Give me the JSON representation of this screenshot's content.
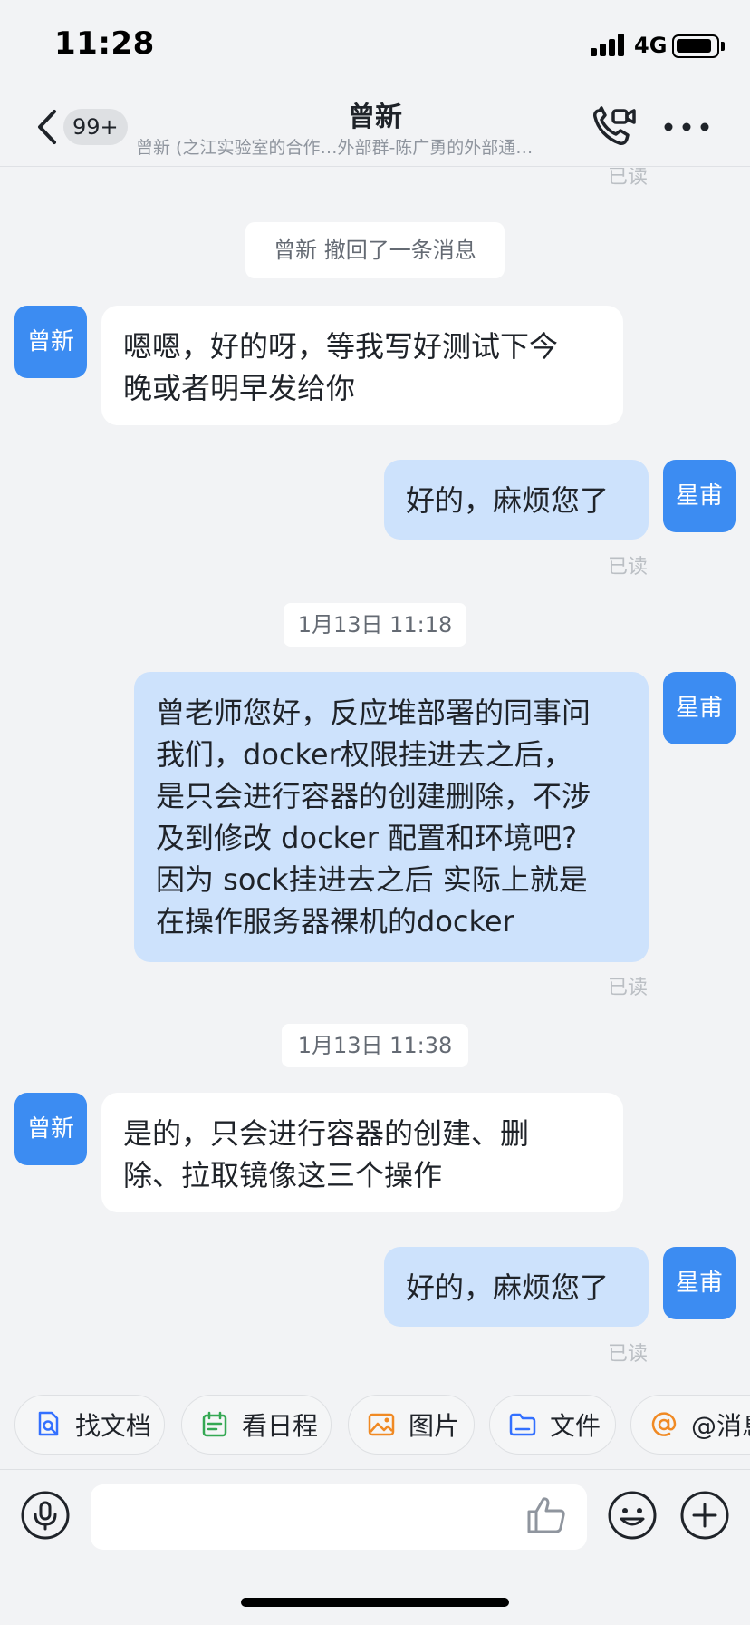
{
  "status_bar": {
    "time": "11:28",
    "network": "4G",
    "icons": [
      "signal-icon",
      "battery-icon"
    ]
  },
  "nav": {
    "badge": "99+",
    "title": "曾新",
    "subtitle": "曾新 (之江实验室的合作…外部群-陈广勇的外部通…",
    "icons": [
      "back-chevron-icon",
      "video-call-icon",
      "more-icon"
    ]
  },
  "messages": {
    "top_read": "已读",
    "recall": "曾新 撤回了一条消息",
    "m1": {
      "sender_avatar": "曾新",
      "lines": [
        "嗯嗯，好的呀，等我写好测试下今",
        "晚或者明早发给你"
      ]
    },
    "m2": {
      "sender_avatar": "星甫",
      "text": "好的，麻烦您了",
      "status": "已读"
    },
    "time1": "1月13日 11:18",
    "m3": {
      "sender_avatar": "星甫",
      "lines": [
        "曾老师您好，反应堆部署的同事问",
        "我们，docker权限挂进去之后，",
        "是只会进行容器的创建删除，不涉",
        "及到修改 docker 配置和环境吧?",
        "因为 sock挂进去之后 实际上就是",
        "在操作服务器裸机的docker"
      ],
      "status": "已读"
    },
    "time2": "1月13日 11:38",
    "m4": {
      "sender_avatar": "曾新",
      "lines": [
        "是的，只会进行容器的创建、删",
        "除、拉取镜像这三个操作"
      ]
    },
    "m5": {
      "sender_avatar": "星甫",
      "text": "好的，麻烦您了",
      "status": "已读"
    }
  },
  "quick_actions": [
    {
      "label": "找文档",
      "icon": "find-document-icon",
      "color": "#3370ff"
    },
    {
      "label": "看日程",
      "icon": "calendar-icon",
      "color": "#34a853"
    },
    {
      "label": "图片",
      "icon": "image-icon",
      "color": "#f08a24"
    },
    {
      "label": "文件",
      "icon": "folder-icon",
      "color": "#3370ff"
    },
    {
      "label": "@消息",
      "icon": "at-icon",
      "color": "#f08a24"
    }
  ],
  "input": {
    "placeholder": "",
    "icons": [
      "microphone-icon",
      "thumbs-up-icon",
      "emoji-icon",
      "plus-icon"
    ]
  },
  "colors": {
    "avatar": "#3c8cf2",
    "outgoing_bubble": "#cde2fc",
    "incoming_bubble": "#ffffff",
    "background": "#f2f3f5"
  }
}
